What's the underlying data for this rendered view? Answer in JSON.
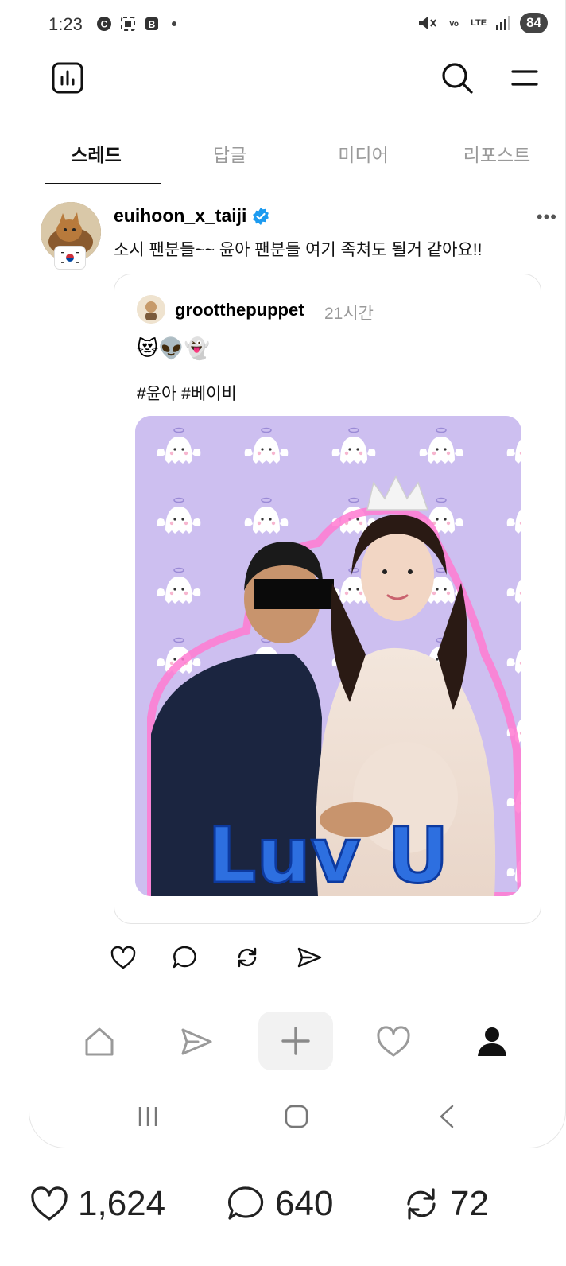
{
  "status_bar": {
    "time": "1:23",
    "network": "LTE",
    "battery": "84"
  },
  "tabs": [
    {
      "label": "스레드",
      "active": true
    },
    {
      "label": "답글",
      "active": false
    },
    {
      "label": "미디어",
      "active": false
    },
    {
      "label": "리포스트",
      "active": false
    }
  ],
  "post": {
    "username": "euihoon_x_taiji",
    "verified": true,
    "more_label": "•••",
    "text": "소시 팬분들~~ 윤아 팬분들 여기 족쳐도 될거 같아요!!",
    "quoted": {
      "username": "grootthepuppet",
      "time": "21시간",
      "emojis": "😻👽👻",
      "hashtags": "#윤아 #베이비",
      "image_overlay_text": "Luv U"
    }
  },
  "engagement": {
    "likes": "1,624",
    "replies": "640",
    "reposts": "72"
  },
  "colors": {
    "accent": "#111111",
    "verified": "#1d9bf0",
    "muted": "#999999",
    "photo_bg": "#cdbff0",
    "overlay_text": "#2d6fe0"
  }
}
